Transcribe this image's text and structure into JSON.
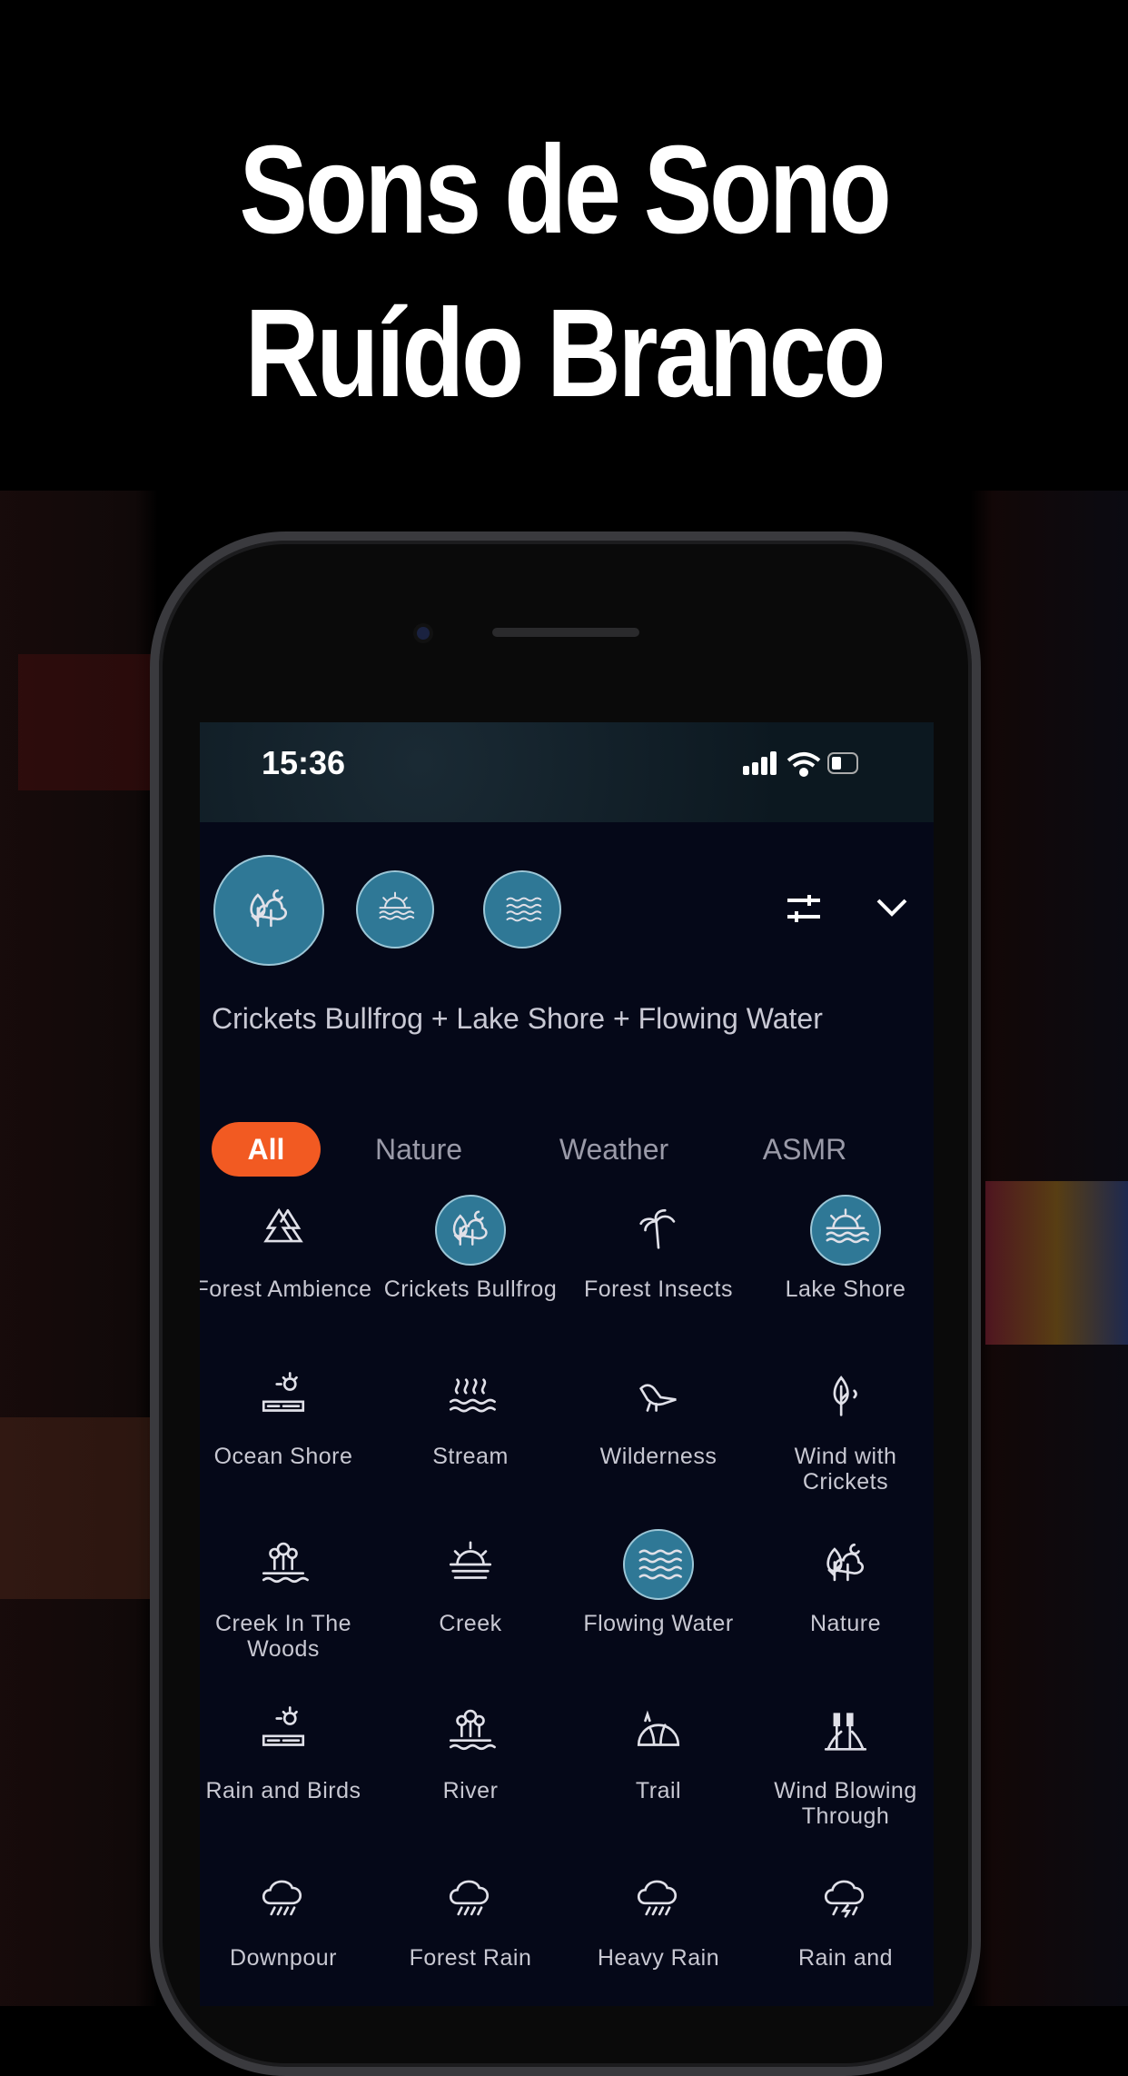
{
  "headline": {
    "line1": "Sons de Sono",
    "line2": "Ruído Branco"
  },
  "status_bar": {
    "time": "15:36"
  },
  "now_playing": {
    "mix_title": "Crickets Bullfrog + Lake Shore + Flowing Water",
    "active_sounds": [
      {
        "icon": "forest-moon-icon"
      },
      {
        "icon": "sunset-water-icon"
      },
      {
        "icon": "waves-icon"
      }
    ]
  },
  "tabs": [
    {
      "label": "All",
      "active": true
    },
    {
      "label": "Nature"
    },
    {
      "label": "Weather"
    },
    {
      "label": "ASMR"
    }
  ],
  "colors": {
    "accent": "#f25a22",
    "selected": "#2f7896",
    "background": "#050818"
  },
  "sounds": [
    {
      "label": "Forest Ambience",
      "icon": "pine-trees-icon"
    },
    {
      "label": "Crickets Bullfrog",
      "icon": "forest-moon-icon",
      "selected": true
    },
    {
      "label": "Forest Insects",
      "icon": "palm-tree-icon"
    },
    {
      "label": "Lake Shore",
      "icon": "sunset-water-icon",
      "selected": true
    },
    {
      "label": "Ocean Shore",
      "icon": "sun-shore-icon"
    },
    {
      "label": "Stream",
      "icon": "steam-waves-icon"
    },
    {
      "label": "Wilderness",
      "icon": "bird-icon"
    },
    {
      "label": "Wind with Crickets",
      "icon": "leaf-sound-icon"
    },
    {
      "label": "Creek In The Woods",
      "icon": "trees-water-icon"
    },
    {
      "label": "Creek",
      "icon": "sunrise-icon"
    },
    {
      "label": "Flowing Water",
      "icon": "waves-icon",
      "selected": true
    },
    {
      "label": "Nature",
      "icon": "forest-moon-icon"
    },
    {
      "label": "Rain and Birds",
      "icon": "sun-shore-icon"
    },
    {
      "label": "River",
      "icon": "trees-water-icon"
    },
    {
      "label": "Trail",
      "icon": "hill-icon"
    },
    {
      "label": "Wind Blowing Through",
      "icon": "reeds-icon"
    },
    {
      "label": "Downpour",
      "icon": "rain-cloud-icon"
    },
    {
      "label": "Forest Rain",
      "icon": "rain-cloud-icon"
    },
    {
      "label": "Heavy Rain",
      "icon": "rain-cloud-icon"
    },
    {
      "label": "Rain and",
      "icon": "storm-cloud-icon"
    }
  ]
}
